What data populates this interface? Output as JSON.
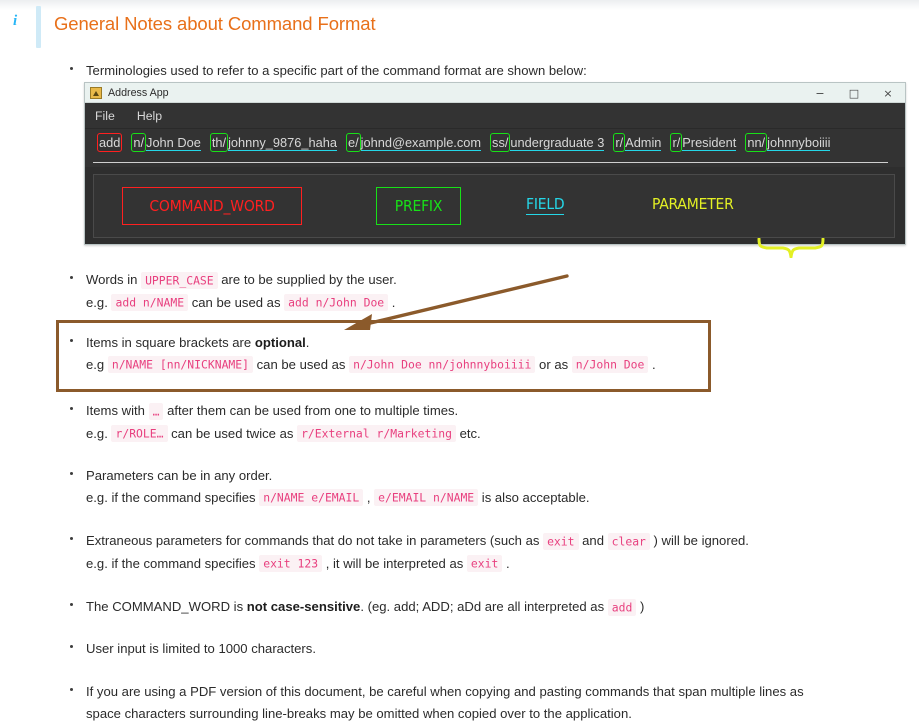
{
  "note": {
    "icon": "info-icon",
    "icon_glyph": "i",
    "title": "General Notes about Command Format",
    "accent_color": "#e8701a",
    "icon_color": "#29b6f6",
    "bar_color": "#cfeaf7"
  },
  "intro_bullet": "Terminologies used to refer to a specific part of the command format are shown below:",
  "app_window": {
    "title": "Address App",
    "logo": "address-app-logo",
    "window_controls": {
      "minimize": "−",
      "maximize": "□",
      "close": "×"
    },
    "menu": [
      "File",
      "Help"
    ],
    "command_tokens": [
      {
        "prefix": "add",
        "field": "",
        "box": "red"
      },
      {
        "prefix": "n/",
        "field": "John Doe",
        "box": "green"
      },
      {
        "prefix": "th/",
        "field": "johnny_9876_haha",
        "box": "green"
      },
      {
        "prefix": "e/",
        "field": "johnd@example.com",
        "box": "green"
      },
      {
        "prefix": "ss/",
        "field": "undergraduate 3",
        "box": "green"
      },
      {
        "prefix": "r/",
        "field": "Admin",
        "box": "green"
      },
      {
        "prefix": "r/",
        "field": "President",
        "box": "green"
      },
      {
        "prefix": "nn/",
        "field": "johnnyboiiii",
        "box": "green"
      }
    ],
    "legend": {
      "command_word": "COMMAND_WORD",
      "prefix": "PREFIX",
      "field": "FIELD",
      "parameter": "PARAMETER"
    },
    "colors": {
      "command_word": "#ff2020",
      "prefix": "#18e018",
      "field": "#25d7e8",
      "parameter": "#e3f024",
      "window_bg": "#2e2e2e",
      "panel_bg": "#333333",
      "titlebar_bg": "#eaf2f0"
    }
  },
  "bullets": {
    "upper_case": {
      "line1_pre": "Words in ",
      "line1_code": "UPPER_CASE",
      "line1_post": " are to be supplied by the user.",
      "line2_pre": "e.g. ",
      "line2_code1": "add n/NAME",
      "line2_mid": " can be used as ",
      "line2_code2": "add n/John Doe",
      "line2_post": " ."
    },
    "optional": {
      "line1_pre": "Items in square brackets are ",
      "line1_bold": "optional",
      "line1_post": ".",
      "line2_pre": "e.g ",
      "line2_code1": "n/NAME [nn/NICKNAME]",
      "line2_mid": " can be used as ",
      "line2_code2": "n/John Doe nn/johnnyboiiii",
      "line2_mid2": " or as ",
      "line2_code3": "n/John Doe",
      "line2_post": " .",
      "highlight_border_color": "#8b5a2b",
      "annotation": "brown-arrow-pointing-to-optional-note"
    },
    "ellipsis": {
      "line1_pre": "Items with ",
      "line1_code": "…",
      "line1_post": " after them can be used from one to multiple times.",
      "line2_pre": "e.g. ",
      "line2_code1": "r/ROLE…",
      "line2_mid": " can be used twice as ",
      "line2_code2": "r/External r/Marketing",
      "line2_post": " etc."
    },
    "any_order": {
      "line1": "Parameters can be in any order.",
      "line2_pre": "e.g. if the command specifies ",
      "line2_code1": "n/NAME e/EMAIL",
      "line2_mid": " , ",
      "line2_code2": "e/EMAIL n/NAME",
      "line2_post": " is also acceptable."
    },
    "extraneous": {
      "line1_pre": "Extraneous parameters for commands that do not take in parameters (such as ",
      "line1_code1": "exit",
      "line1_mid": " and ",
      "line1_code2": "clear",
      "line1_post": " ) will be ignored.",
      "line2_pre": "e.g. if the command specifies ",
      "line2_code1": "exit 123",
      "line2_mid": " , it will be interpreted as ",
      "line2_code2": "exit",
      "line2_post": " ."
    },
    "case_sensitive": {
      "line1_pre": "The COMMAND_WORD is ",
      "line1_bold": "not case-sensitive",
      "line1_mid": ". (eg. add; ADD; aDd are all interpreted as ",
      "line1_code": "add",
      "line1_post": " )"
    },
    "char_limit": {
      "line1": "User input is limited to 1000 characters."
    },
    "pdf_note": {
      "line1": "If you are using a PDF version of this document, be careful when copying and pasting commands that span multiple lines as",
      "line2": "space characters surrounding line-breaks may be omitted when copied over to the application."
    }
  }
}
